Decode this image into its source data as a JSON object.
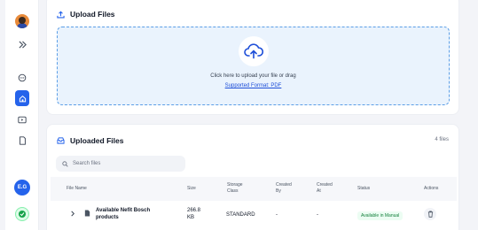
{
  "sidebar": {
    "user_badge": "E.G"
  },
  "upload": {
    "title": "Upload Files",
    "instruction": "Click here to upload your file or drag",
    "format_link": "Supported Format: PDF"
  },
  "uploaded": {
    "title": "Uploaded Files",
    "count": "4 files",
    "search_placeholder": "Search files",
    "columns": {
      "file_name": "File Name",
      "size": "Size",
      "storage_class_1": "Storage",
      "storage_class_2": "Class",
      "created_by_1": "Created",
      "created_by_2": "By",
      "created_at_1": "Created",
      "created_at_2": "At",
      "status": "Status",
      "actions": "Actions"
    },
    "rows": [
      {
        "name_1": "Available Nefit Bosch",
        "name_2": "products",
        "size_1": "266.8",
        "size_2": "KB",
        "storage_class": "STANDARD",
        "created_by": "-",
        "created_at": "-",
        "status": "Available in Manual"
      }
    ]
  },
  "colors": {
    "accent": "#2563eb",
    "dropzone_bg": "#eaf3fd",
    "status_green": "#15803d"
  }
}
